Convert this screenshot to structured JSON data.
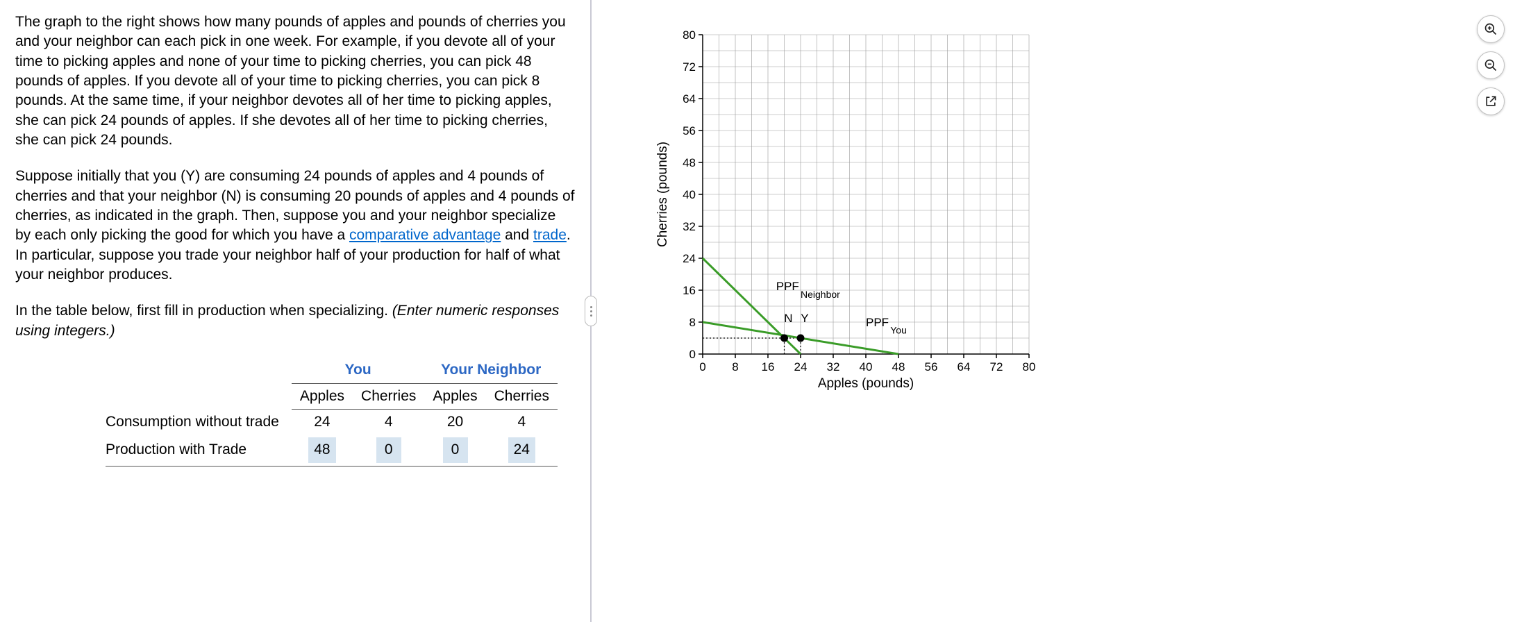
{
  "problem": {
    "para1": "The graph to the right shows how many pounds of apples and pounds of cherries you and your neighbor can each pick in one week.  For example, if you devote all of your time to picking apples and none of your time to picking cherries, you can pick 48 pounds of apples.  If you devote all of your time to picking cherries, you can pick 8 pounds.  At the same time, if your neighbor devotes all of her time to picking apples, she can pick 24 pounds of apples.  If she devotes all of her time to picking cherries, she can pick 24 pounds.",
    "para2_pre": "Suppose initially that you (Y) are consuming 24 pounds of apples and 4 pounds of cherries and that your neighbor (N) is consuming 20 pounds of apples and 4 pounds of cherries, as indicated in the graph.  Then, suppose you and your neighbor specialize by each only picking the good for which you have a ",
    "link_comp_adv": "comparative advantage",
    "para2_mid": " and ",
    "link_trade": "trade",
    "para2_post": ".  In particular, suppose you trade your neighbor half of your production for half of what your neighbor produces.",
    "para3_pre": "In the table below, first fill in production when specializing.  ",
    "para3_italic": "(Enter numeric responses using integers.)"
  },
  "table": {
    "group_you": "You",
    "group_neighbor": "Your Neighbor",
    "col_apples": "Apples",
    "col_cherries": "Cherries",
    "row1_label": "Consumption without trade",
    "row1": {
      "you_apples": "24",
      "you_cherries": "4",
      "n_apples": "20",
      "n_cherries": "4"
    },
    "row2_label": "Production with Trade",
    "row2": {
      "you_apples": "48",
      "you_cherries": "0",
      "n_apples": "0",
      "n_cherries": "24"
    }
  },
  "chart_data": {
    "type": "line",
    "title": "",
    "xlabel": "Apples (pounds)",
    "ylabel": "Cherries (pounds)",
    "xlim": [
      0,
      80
    ],
    "ylim": [
      0,
      80
    ],
    "x_ticks": [
      0,
      8,
      16,
      24,
      32,
      40,
      48,
      56,
      64,
      72,
      80
    ],
    "y_ticks": [
      0,
      8,
      16,
      24,
      32,
      40,
      48,
      56,
      64,
      72,
      80
    ],
    "series": [
      {
        "name": "PPF_Neighbor",
        "x": [
          0,
          24
        ],
        "y": [
          24,
          0
        ],
        "color": "#3a9c28"
      },
      {
        "name": "PPF_You",
        "x": [
          0,
          48
        ],
        "y": [
          8,
          0
        ],
        "color": "#3a9c28"
      }
    ],
    "points": [
      {
        "name": "N",
        "x": 20,
        "y": 4
      },
      {
        "name": "Y",
        "x": 24,
        "y": 4
      }
    ],
    "annotations": [
      {
        "text": "PPF",
        "x": 18,
        "y": 16,
        "sub": "Neighbor",
        "subx": 24,
        "suby": 15
      },
      {
        "text": "N",
        "x": 21,
        "y": 8
      },
      {
        "text": "Y",
        "x": 25,
        "y": 8
      },
      {
        "text": "PPF",
        "x": 40,
        "y": 7,
        "sub": "You",
        "subx": 46,
        "suby": 6
      }
    ],
    "guides": [
      {
        "type": "dotted-h",
        "y": 4,
        "x0": 0,
        "x1": 24
      },
      {
        "type": "dotted-v",
        "x": 20,
        "y0": 0,
        "y1": 4
      },
      {
        "type": "dotted-v",
        "x": 24,
        "y0": 0,
        "y1": 4
      }
    ]
  },
  "tools": {
    "zoom_in": "zoom-in",
    "zoom_out": "zoom-out",
    "popout": "open-in-new"
  }
}
